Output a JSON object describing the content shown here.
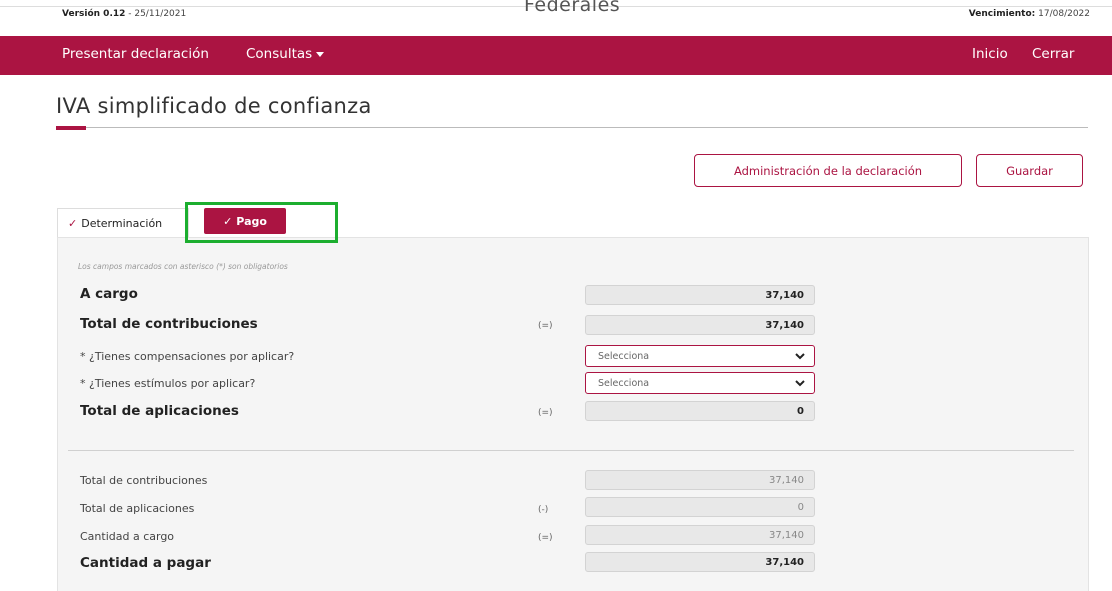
{
  "header": {
    "version_label": "Versión 0.12",
    "version_date": " - 25/11/2021",
    "center_title": "Federales",
    "vencimiento_label": "Vencimiento:",
    "vencimiento_date": " 17/08/2022"
  },
  "navbar": {
    "presentar": "Presentar declaración",
    "consultas": "Consultas",
    "inicio": "Inicio",
    "cerrar": "Cerrar",
    "color": "#ab1442"
  },
  "page": {
    "title": "IVA simplificado de confianza"
  },
  "actions": {
    "admin": "Administración de la declaración",
    "guardar": "Guardar"
  },
  "tabs": {
    "determinacion": "Determinación",
    "pago": "Pago",
    "check_icon": "check-icon"
  },
  "form": {
    "hint": "Los campos marcados con asterisco (*) son obligatorios",
    "a_cargo": {
      "label": "A cargo",
      "value": "37,140"
    },
    "total_contribuciones": {
      "label": "Total de contribuciones",
      "op": "(=)",
      "value": "37,140"
    },
    "compensaciones": {
      "label": "* ¿Tienes compensaciones por aplicar?",
      "selected": "Selecciona"
    },
    "estimulos": {
      "label": "* ¿Tienes estímulos por aplicar?",
      "selected": "Selecciona"
    },
    "total_aplicaciones": {
      "label": "Total de aplicaciones",
      "op": "(=)",
      "value": "0"
    }
  },
  "summary": {
    "total_contribuciones": {
      "label": "Total de contribuciones",
      "value": "37,140"
    },
    "total_aplicaciones": {
      "label": "Total de aplicaciones",
      "op": "(-)",
      "value": "0"
    },
    "cantidad_cargo": {
      "label": "Cantidad a cargo",
      "op": "(=)",
      "value": "37,140"
    },
    "cantidad_pagar": {
      "label": "Cantidad a pagar",
      "value": "37,140"
    }
  },
  "colors": {
    "brand": "#ab1442",
    "highlight": "#1cae2f"
  }
}
